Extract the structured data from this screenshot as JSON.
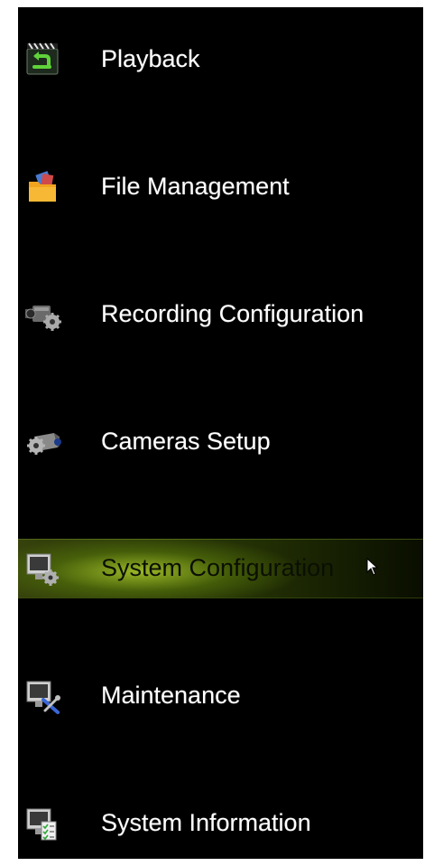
{
  "menu": {
    "items": [
      {
        "label": "Playback",
        "icon": "playback-clapper-icon"
      },
      {
        "label": "File Management",
        "icon": "folder-icon"
      },
      {
        "label": "Recording Configuration",
        "icon": "camcorder-gear-icon"
      },
      {
        "label": "Cameras Setup",
        "icon": "camera-gear-icon"
      },
      {
        "label": "System Configuration",
        "icon": "monitor-gear-icon",
        "selected": true
      },
      {
        "label": "Maintenance",
        "icon": "monitor-wrench-icon"
      },
      {
        "label": "System Information",
        "icon": "monitor-checklist-icon"
      }
    ]
  },
  "colors": {
    "background": "#000000",
    "text": "#ffffff",
    "selected_highlight": "#8aa820",
    "selected_text": "#0b0f02"
  }
}
